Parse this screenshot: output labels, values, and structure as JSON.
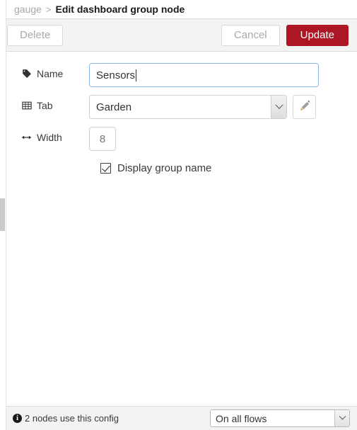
{
  "breadcrumb": {
    "parent": "gauge",
    "separator": ">",
    "current": "Edit dashboard group node"
  },
  "toolbar": {
    "delete_label": "Delete",
    "cancel_label": "Cancel",
    "update_label": "Update",
    "update_color": "#ad1625"
  },
  "form": {
    "name": {
      "label": "Name",
      "icon": "tag-icon",
      "value": "Sensors",
      "placeholder": "Name",
      "focused": true
    },
    "tab": {
      "label": "Tab",
      "icon": "table-icon",
      "value": "Garden",
      "options": [
        "Garden"
      ],
      "edit_button_icon": "pencil-icon"
    },
    "width": {
      "label": "Width",
      "icon": "arrows-horizontal-icon",
      "value": "",
      "placeholder": "8"
    },
    "display_group_name": {
      "label": "Display group name",
      "checked": true
    }
  },
  "footer": {
    "info_icon": "info-circle-icon",
    "usage_text": "2 nodes use this config",
    "scope_value": "On all flows",
    "scope_options": [
      "On all flows"
    ]
  }
}
